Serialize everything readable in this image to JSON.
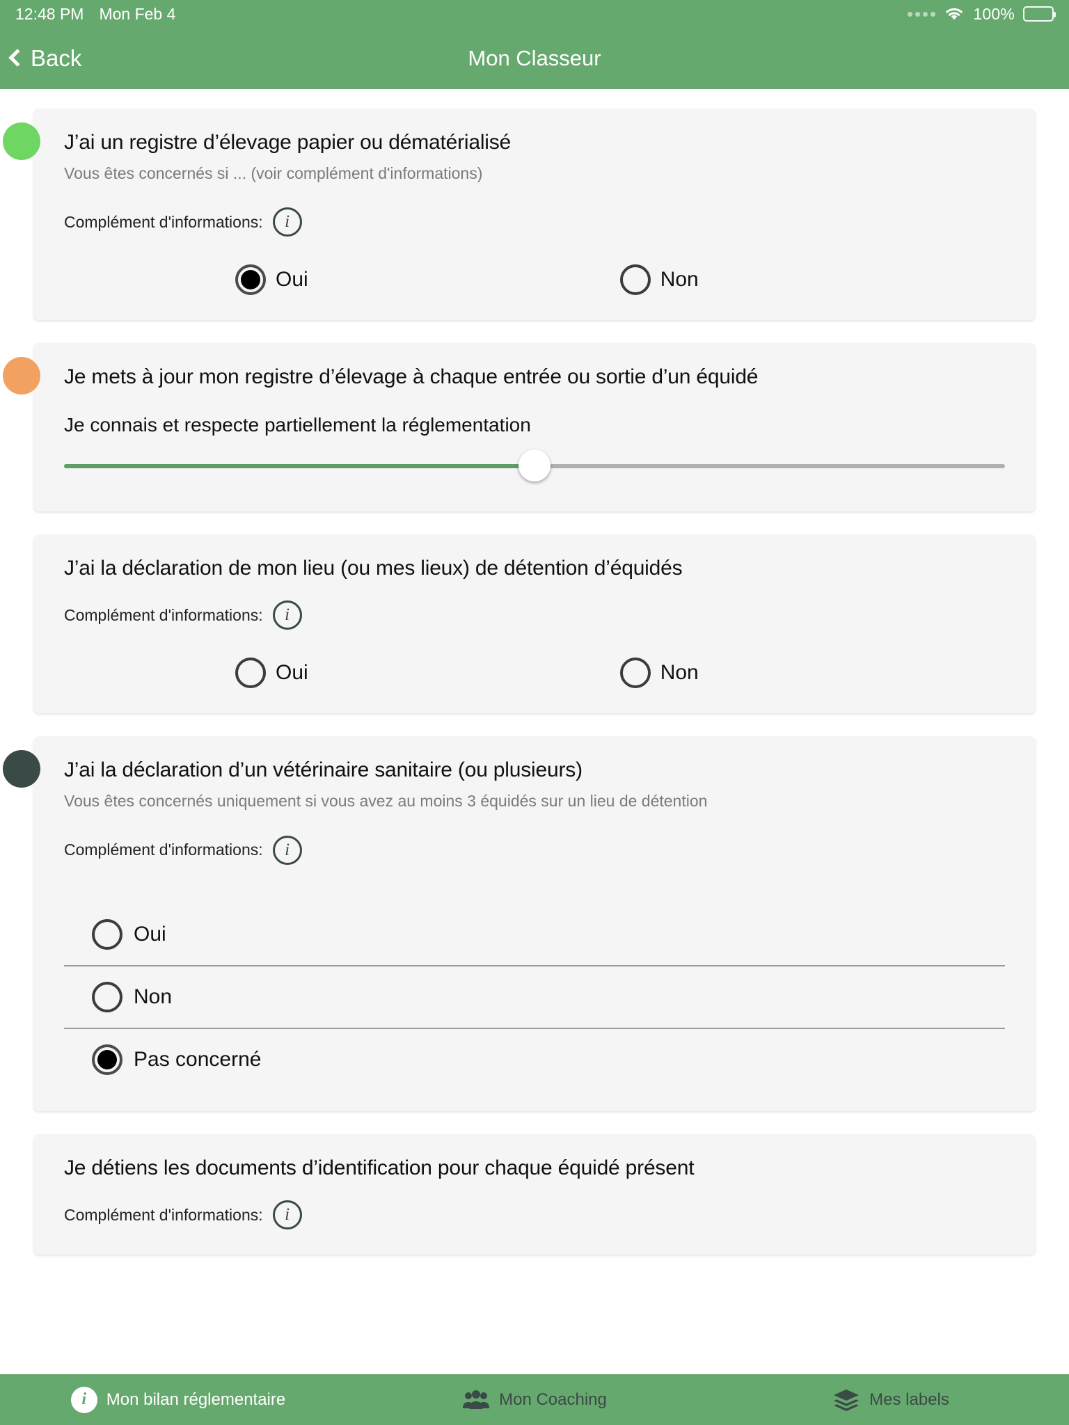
{
  "status_bar": {
    "time": "12:48 PM",
    "date": "Mon Feb 4",
    "battery_percent": "100%",
    "wifi_icon": "wifi-icon",
    "signal_icon": "signal-dots-icon",
    "battery_icon": "battery-full-icon"
  },
  "nav": {
    "back_label": "Back",
    "title": "Mon Classeur",
    "back_icon": "chevron-left-icon"
  },
  "colors": {
    "brand_green": "#66a96e",
    "dot_green": "#6fd663",
    "dot_orange": "#f2a161",
    "dot_dark": "#3a4a47",
    "slider_fill": "#5e9e66",
    "slider_track": "#b0b0b0",
    "card_bg": "#f5f5f5"
  },
  "common": {
    "complement_label": "Complément d'informations:",
    "info_icon": "info-icon",
    "info_glyph": "i"
  },
  "cards": [
    {
      "status_dot": "green",
      "title": "J’ai un registre d’élevage papier ou dématérialisé",
      "subtitle": "Vous êtes concernés si ... (voir complément d'informations)",
      "has_complement": true,
      "control": "radio-horizontal",
      "options": [
        {
          "label": "Oui",
          "checked": true
        },
        {
          "label": "Non",
          "checked": false
        }
      ]
    },
    {
      "status_dot": "orange",
      "title": "Je mets à jour mon registre d’élevage à chaque entrée ou sortie d’un équidé",
      "subtitle": "",
      "has_complement": false,
      "control": "slider",
      "slider": {
        "value_label": "Je connais et respecte partiellement la réglementation",
        "percent": 50
      }
    },
    {
      "status_dot": "none",
      "title": "J’ai la déclaration de mon lieu (ou mes lieux) de détention d’équidés",
      "subtitle": "",
      "has_complement": true,
      "control": "radio-horizontal",
      "options": [
        {
          "label": "Oui",
          "checked": false
        },
        {
          "label": "Non",
          "checked": false
        }
      ]
    },
    {
      "status_dot": "dark",
      "title": "J’ai la déclaration d’un vétérinaire sanitaire (ou plusieurs)",
      "subtitle": "Vous êtes concernés uniquement si vous avez au moins 3 équidés sur un lieu de détention",
      "has_complement": true,
      "control": "radio-list",
      "options": [
        {
          "label": "Oui",
          "checked": false
        },
        {
          "label": "Non",
          "checked": false
        },
        {
          "label": "Pas concerné",
          "checked": true
        }
      ]
    },
    {
      "status_dot": "none",
      "title": "Je détiens les documents d’identification pour chaque équidé présent",
      "subtitle": "",
      "has_complement": true,
      "control": "none",
      "options": []
    }
  ],
  "tab_bar": {
    "items": [
      {
        "label": "Mon bilan réglementaire",
        "icon": "info-filled-icon",
        "active": true
      },
      {
        "label": "Mon Coaching",
        "icon": "people-group-icon",
        "active": false
      },
      {
        "label": "Mes labels",
        "icon": "layers-icon",
        "active": false
      }
    ]
  }
}
